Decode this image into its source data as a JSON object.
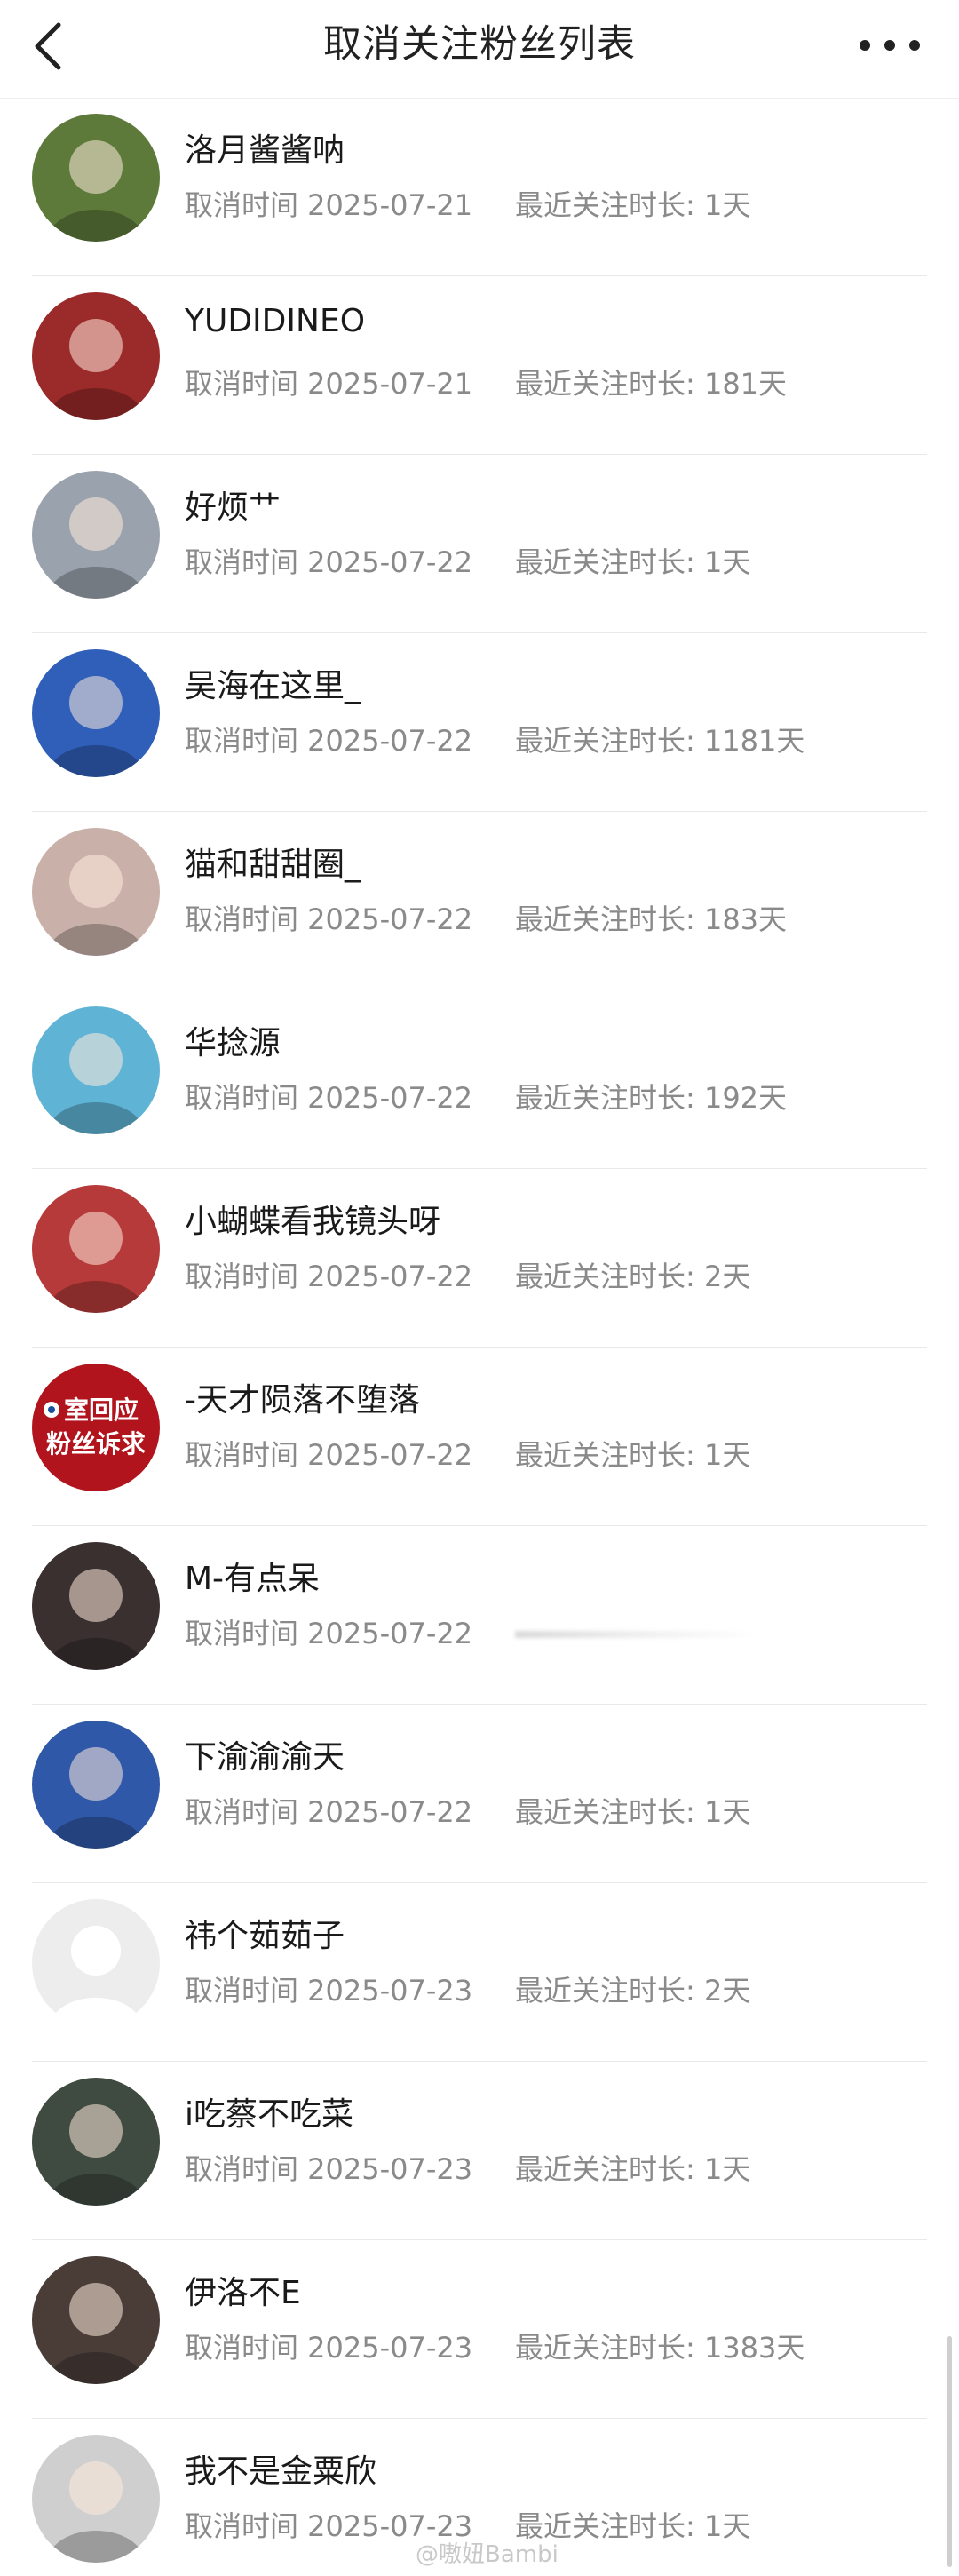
{
  "header": {
    "title": "取消关注粉丝列表"
  },
  "list": [
    {
      "name": "洛月酱酱呐",
      "cancel_time": "取消时间 2025-07-21",
      "duration": "最近关注时长: 1天",
      "avatar_icon": "avatar-photo",
      "avatar_color": "#5d7a3a"
    },
    {
      "name": "YUDIDINEO",
      "cancel_time": "取消时间 2025-07-21",
      "duration": "最近关注时长: 181天",
      "avatar_icon": "avatar-photo",
      "avatar_color": "#9b2a2a"
    },
    {
      "name": "好烦艹",
      "cancel_time": "取消时间 2025-07-22",
      "duration": "最近关注时长: 1天",
      "avatar_icon": "avatar-photo",
      "avatar_color": "#9aa3ad"
    },
    {
      "name": "吴海在这里_",
      "cancel_time": "取消时间 2025-07-22",
      "duration": "最近关注时长: 1181天",
      "avatar_icon": "avatar-photo",
      "avatar_color": "#2f5fb8"
    },
    {
      "name": "猫和甜甜圈_",
      "cancel_time": "取消时间 2025-07-22",
      "duration": "最近关注时长: 183天",
      "avatar_icon": "avatar-photo",
      "avatar_color": "#c9b0a8"
    },
    {
      "name": "华捻源",
      "cancel_time": "取消时间 2025-07-22",
      "duration": "最近关注时长: 192天",
      "avatar_icon": "avatar-photo",
      "avatar_color": "#5fb4d6"
    },
    {
      "name": "小蝴蝶看我镜头呀",
      "cancel_time": "取消时间 2025-07-22",
      "duration": "最近关注时长: 2天",
      "avatar_icon": "avatar-photo",
      "avatar_color": "#b63a3a"
    },
    {
      "name": "-天才陨落不堕落",
      "cancel_time": "取消时间 2025-07-22",
      "duration": "最近关注时长: 1天",
      "avatar_icon": "avatar-text-badge",
      "avatar_color": "#b1141c",
      "avatar_text_1": "室回应",
      "avatar_text_2": "粉丝诉求"
    },
    {
      "name": "M-有点呆",
      "cancel_time": "取消时间 2025-07-22",
      "duration": "",
      "avatar_icon": "avatar-photo",
      "avatar_color": "#3a3030"
    },
    {
      "name": "下渝渝渝天",
      "cancel_time": "取消时间 2025-07-22",
      "duration": "最近关注时长: 1天",
      "avatar_icon": "avatar-photo",
      "avatar_color": "#3058a8"
    },
    {
      "name": "祎个茹茹子",
      "cancel_time": "取消时间 2025-07-23",
      "duration": "最近关注时长: 2天",
      "avatar_icon": "default-avatar-icon",
      "avatar_color": "#ededed"
    },
    {
      "name": "i吃蔡不吃菜",
      "cancel_time": "取消时间 2025-07-23",
      "duration": "最近关注时长: 1天",
      "avatar_icon": "avatar-photo",
      "avatar_color": "#3f4a40"
    },
    {
      "name": "伊洛不E",
      "cancel_time": "取消时间 2025-07-23",
      "duration": "最近关注时长: 1383天",
      "avatar_icon": "avatar-photo",
      "avatar_color": "#4a3d38"
    },
    {
      "name": "我不是金粟欣",
      "cancel_time": "取消时间 2025-07-23",
      "duration": "最近关注时长: 1天",
      "avatar_icon": "avatar-photo",
      "avatar_color": "#cfcfcf"
    }
  ],
  "watermark": "@嗷妞Bambi"
}
